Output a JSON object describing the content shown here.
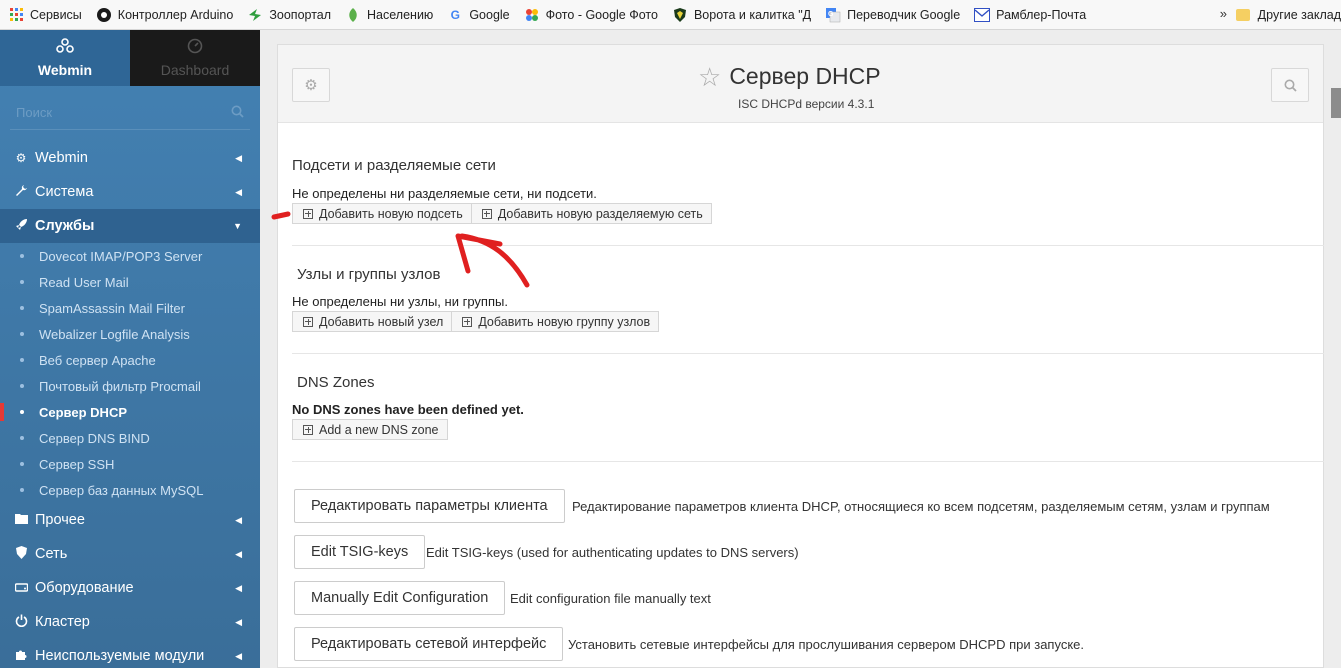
{
  "bookmarks": {
    "items": [
      {
        "label": "Сервисы",
        "icon": "apps-grid-icon"
      },
      {
        "label": "Контроллер Arduino",
        "icon": "arduino-icon"
      },
      {
        "label": "Зоопортал",
        "icon": "zooportal-icon"
      },
      {
        "label": "Населению",
        "icon": "leaf-icon"
      },
      {
        "label": "Google",
        "icon": "google-icon"
      },
      {
        "label": "Фото - Google Фото",
        "icon": "google-photos-icon"
      },
      {
        "label": "Ворота и калитка \"Д",
        "icon": "shield-icon"
      },
      {
        "label": "Переводчик Google",
        "icon": "google-translate-icon"
      },
      {
        "label": "Рамблер-Почта",
        "icon": "mail-icon"
      }
    ],
    "more": "»",
    "other": "Другие заклад"
  },
  "sidebar": {
    "tab_webmin": "Webmin",
    "tab_dashboard": "Dashboard",
    "search_placeholder": "Поиск",
    "menu": [
      {
        "label": "Webmin",
        "icon": "gear-icon"
      },
      {
        "label": "Система",
        "icon": "wrench-icon"
      },
      {
        "label": "Службы",
        "icon": "rocket-icon"
      }
    ],
    "sub": [
      "Dovecot IMAP/POP3 Server",
      "Read User Mail",
      "SpamAssassin Mail Filter",
      "Webalizer Logfile Analysis",
      "Веб сервер Apache",
      "Почтовый фильтр Procmail",
      "Сервер DHCP",
      "Сервер DNS BIND",
      "Сервер SSH",
      "Сервер баз данных MySQL"
    ],
    "menu2": [
      {
        "label": "Прочее",
        "icon": "folder-icon"
      },
      {
        "label": "Сеть",
        "icon": "shield-icon"
      },
      {
        "label": "Оборудование",
        "icon": "hdd-icon"
      },
      {
        "label": "Кластер",
        "icon": "power-icon"
      },
      {
        "label": "Неиспользуемые модули",
        "icon": "puzzle-icon"
      }
    ]
  },
  "header": {
    "title": "Сервер DHCP",
    "subtitle": "ISC DHCPd версии 4.3.1"
  },
  "subnets": {
    "title": "Подсети и разделяемые сети",
    "message": "Не определены ни разделяемые сети, ни подсети.",
    "btn_add_subnet": "Добавить новую подсеть",
    "btn_add_shared": "Добавить новую разделяемую сеть"
  },
  "hosts": {
    "title": "Узлы и группы узлов",
    "message": "Не определены ни узлы, ни группы.",
    "btn_add_host": "Добавить новый узел",
    "btn_add_group": "Добавить новую группу узлов"
  },
  "dns": {
    "title": "DNS Zones",
    "message": "No DNS zones have been defined yet.",
    "btn_add_zone": "Add a new DNS zone"
  },
  "actions": [
    {
      "label": "Редактировать параметры клиента",
      "desc": "Редактирование параметров клиента DHCP, относящиеся ко всем подсетям, разделяемым сетям, узлам и группам"
    },
    {
      "label": "Edit TSIG-keys",
      "desc": "Edit TSIG-keys (used for authenticating updates to DNS servers)"
    },
    {
      "label": "Manually Edit Configuration",
      "desc": "Edit configuration file manually text"
    },
    {
      "label": "Редактировать сетевой интерфейс",
      "desc": "Установить сетевые интерфейсы для прослушивания сервером DHCPD при запуске."
    }
  ],
  "colors": {
    "sidebar": "#4381b3",
    "annotation": "#e02020",
    "current_marker": "#e53935"
  }
}
